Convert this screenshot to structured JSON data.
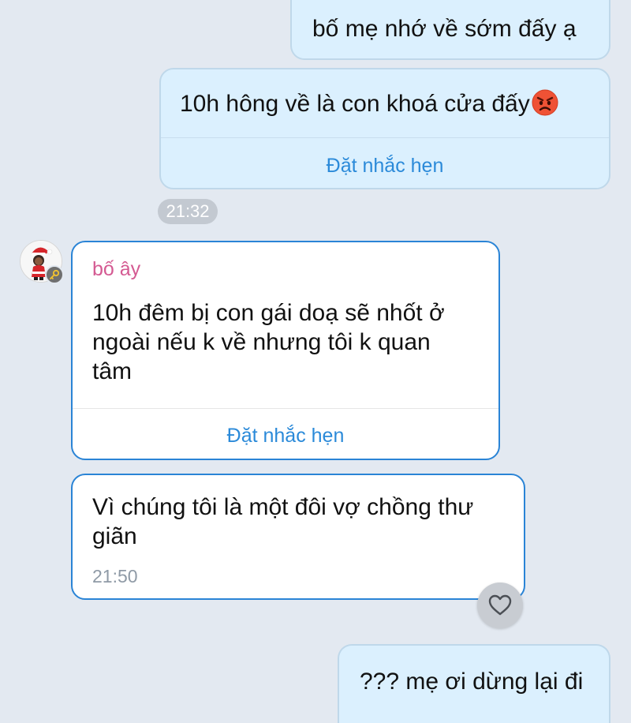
{
  "messages": [
    {
      "id": "m1",
      "direction": "outgoing",
      "text": "bố mẹ nhớ về sớm đấy ạ"
    },
    {
      "id": "m2",
      "direction": "outgoing",
      "text": "10h hông về là con khoá cửa đấy",
      "emoji": "angry-face",
      "action_label": "Đặt nhắc hẹn"
    },
    {
      "id": "m3",
      "direction": "incoming",
      "sender": "bố ây",
      "text": "10h đêm bị con gái doạ sẽ nhốt ở\nngoài nếu k về nhưng tôi k quan\ntâm",
      "action_label": "Đặt nhắc hẹn"
    },
    {
      "id": "m4",
      "direction": "incoming",
      "text": "Vì chúng tôi là một đôi vợ chồng thư\ngiãn",
      "time": "21:50"
    },
    {
      "id": "m5",
      "direction": "outgoing",
      "text": "??? mẹ ơi dừng lại đi"
    }
  ],
  "time_divider": "21:32",
  "react_icon": "heart-outline-icon",
  "avatar_icon": "santa-avatar",
  "colors": {
    "background": "#e3e9f1",
    "outgoing_bubble": "#dbf0fe",
    "incoming_border": "#2a84d6",
    "link": "#2b8ad9",
    "sender_name": "#d45a92"
  }
}
